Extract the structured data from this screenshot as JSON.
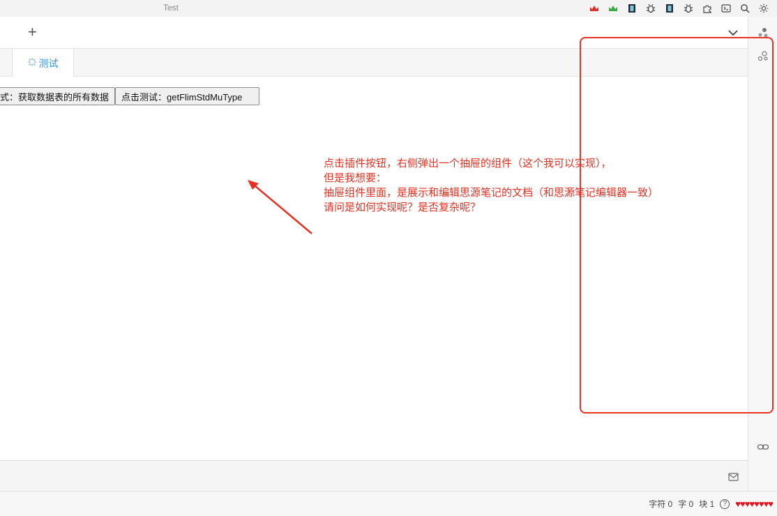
{
  "window": {
    "title": "Test"
  },
  "titlebar_icons": [
    "crown-red-icon",
    "crown-green-icon",
    "film-icon",
    "bug-icon",
    "film-icon",
    "bug-icon",
    "puzzle-icon",
    "terminal-icon",
    "search-icon",
    "sun-icon"
  ],
  "toolbar": {
    "add_label": "+"
  },
  "tabs": [
    {
      "label": "测试",
      "active": true
    }
  ],
  "content": {
    "buttons": [
      {
        "label": "式：获取数据表的所有数据"
      },
      {
        "label": "点击测试：getFlimStdMuType"
      }
    ],
    "annotation": "点击插件按钮，右侧弹出一个抽屉的组件（这个我可以实现），\n但是我想要：\n抽屉组件里面，是展示和编辑思源笔记的文档（和思源笔记编辑器一致）\n请问是如何实现呢？是否复杂呢？"
  },
  "statusbar": {
    "chars": "字符 0",
    "words": "字 0",
    "blocks": "块 1",
    "help": "?",
    "hearts": "♥♥♥♥♥♥♥♥"
  },
  "colors": {
    "annotation": "#e63022",
    "accent": "#3b8fd6",
    "hearts": "#e8101d"
  }
}
